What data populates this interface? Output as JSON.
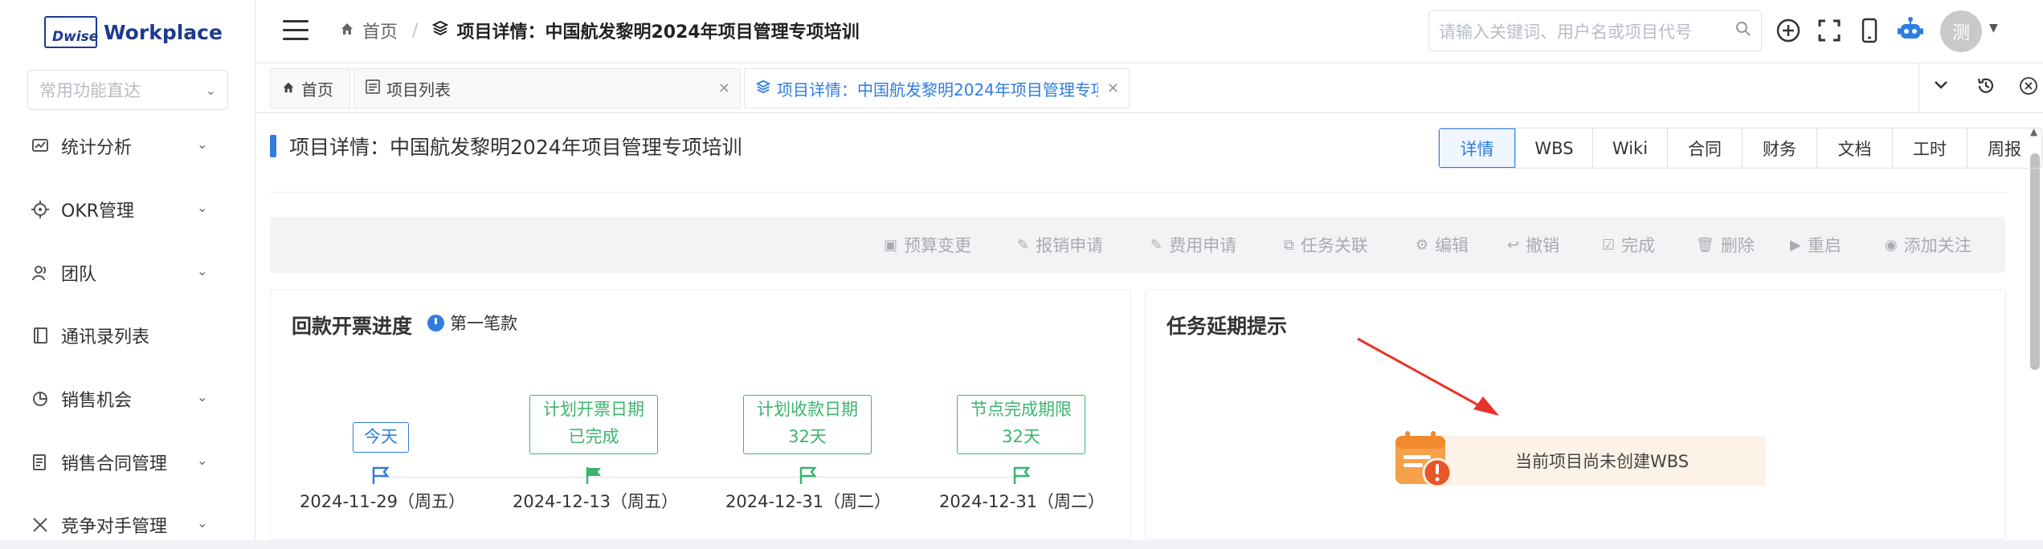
{
  "logo": {
    "mark": "Dwise",
    "word": "Workplace"
  },
  "sidebar": {
    "quick_placeholder": "常用功能直达",
    "items": [
      {
        "label": "统计分析",
        "icon": "chart-icon",
        "expandable": true
      },
      {
        "label": "OKR管理",
        "icon": "target-icon",
        "expandable": true
      },
      {
        "label": "团队",
        "icon": "team-icon",
        "expandable": true
      },
      {
        "label": "通讯录列表",
        "icon": "contacts-icon",
        "expandable": false
      },
      {
        "label": "销售机会",
        "icon": "pie-icon",
        "expandable": true
      },
      {
        "label": "销售合同管理",
        "icon": "contract-icon",
        "expandable": true
      },
      {
        "label": "竞争对手管理",
        "icon": "swords-icon",
        "expandable": true
      }
    ]
  },
  "header": {
    "breadcrumb_home": "首页",
    "breadcrumb_current": "项目详情：中国航发黎明2024年项目管理专项培训",
    "search_placeholder": "请输入关键词、用户名或项目代号",
    "avatar_text": "测"
  },
  "tabs": [
    {
      "label": "首页",
      "icon": "home-icon",
      "closable": false,
      "active": false
    },
    {
      "label": "项目列表",
      "icon": "list-icon",
      "closable": true,
      "active": false
    },
    {
      "label": "项目详情：中国航发黎明2024年项目管理专项:",
      "icon": "layers-icon",
      "closable": true,
      "active": true
    }
  ],
  "page": {
    "title": "项目详情：中国航发黎明2024年项目管理专项培训",
    "subtabs": [
      "详情",
      "WBS",
      "Wiki",
      "合同",
      "财务",
      "文档",
      "工时",
      "周报"
    ],
    "active_subtab": "详情",
    "actions": [
      "预算变更",
      "报销申请",
      "费用申请",
      "任务关联",
      "编辑",
      "撤销",
      "完成",
      "删除",
      "重启",
      "添加关注"
    ]
  },
  "payment": {
    "title": "回款开票进度",
    "subtitle": "第一笔款",
    "timeline": [
      {
        "box_line1": "今天",
        "box_line2": "",
        "date": "2024-11-29（周五）",
        "style": "blue",
        "flag_filled": false
      },
      {
        "box_line1": "计划开票日期",
        "box_line2": "已完成",
        "date": "2024-12-13（周五）",
        "style": "green",
        "flag_filled": true
      },
      {
        "box_line1": "计划收款日期",
        "box_line2": "32天",
        "date": "2024-12-31（周二）",
        "style": "green",
        "flag_filled": false
      },
      {
        "box_line1": "节点完成期限",
        "box_line2": "32天",
        "date": "2024-12-31（周二）",
        "style": "green",
        "flag_filled": false
      }
    ]
  },
  "delay": {
    "title": "任务延期提示",
    "empty_text": "当前项目尚未创建WBS"
  },
  "colors": {
    "primary": "#2f7de0",
    "success": "#3bb56c",
    "warning_bg": "#fdf2e7",
    "accent_orange": "#f5a04a",
    "arrow_red": "#e8332a"
  }
}
